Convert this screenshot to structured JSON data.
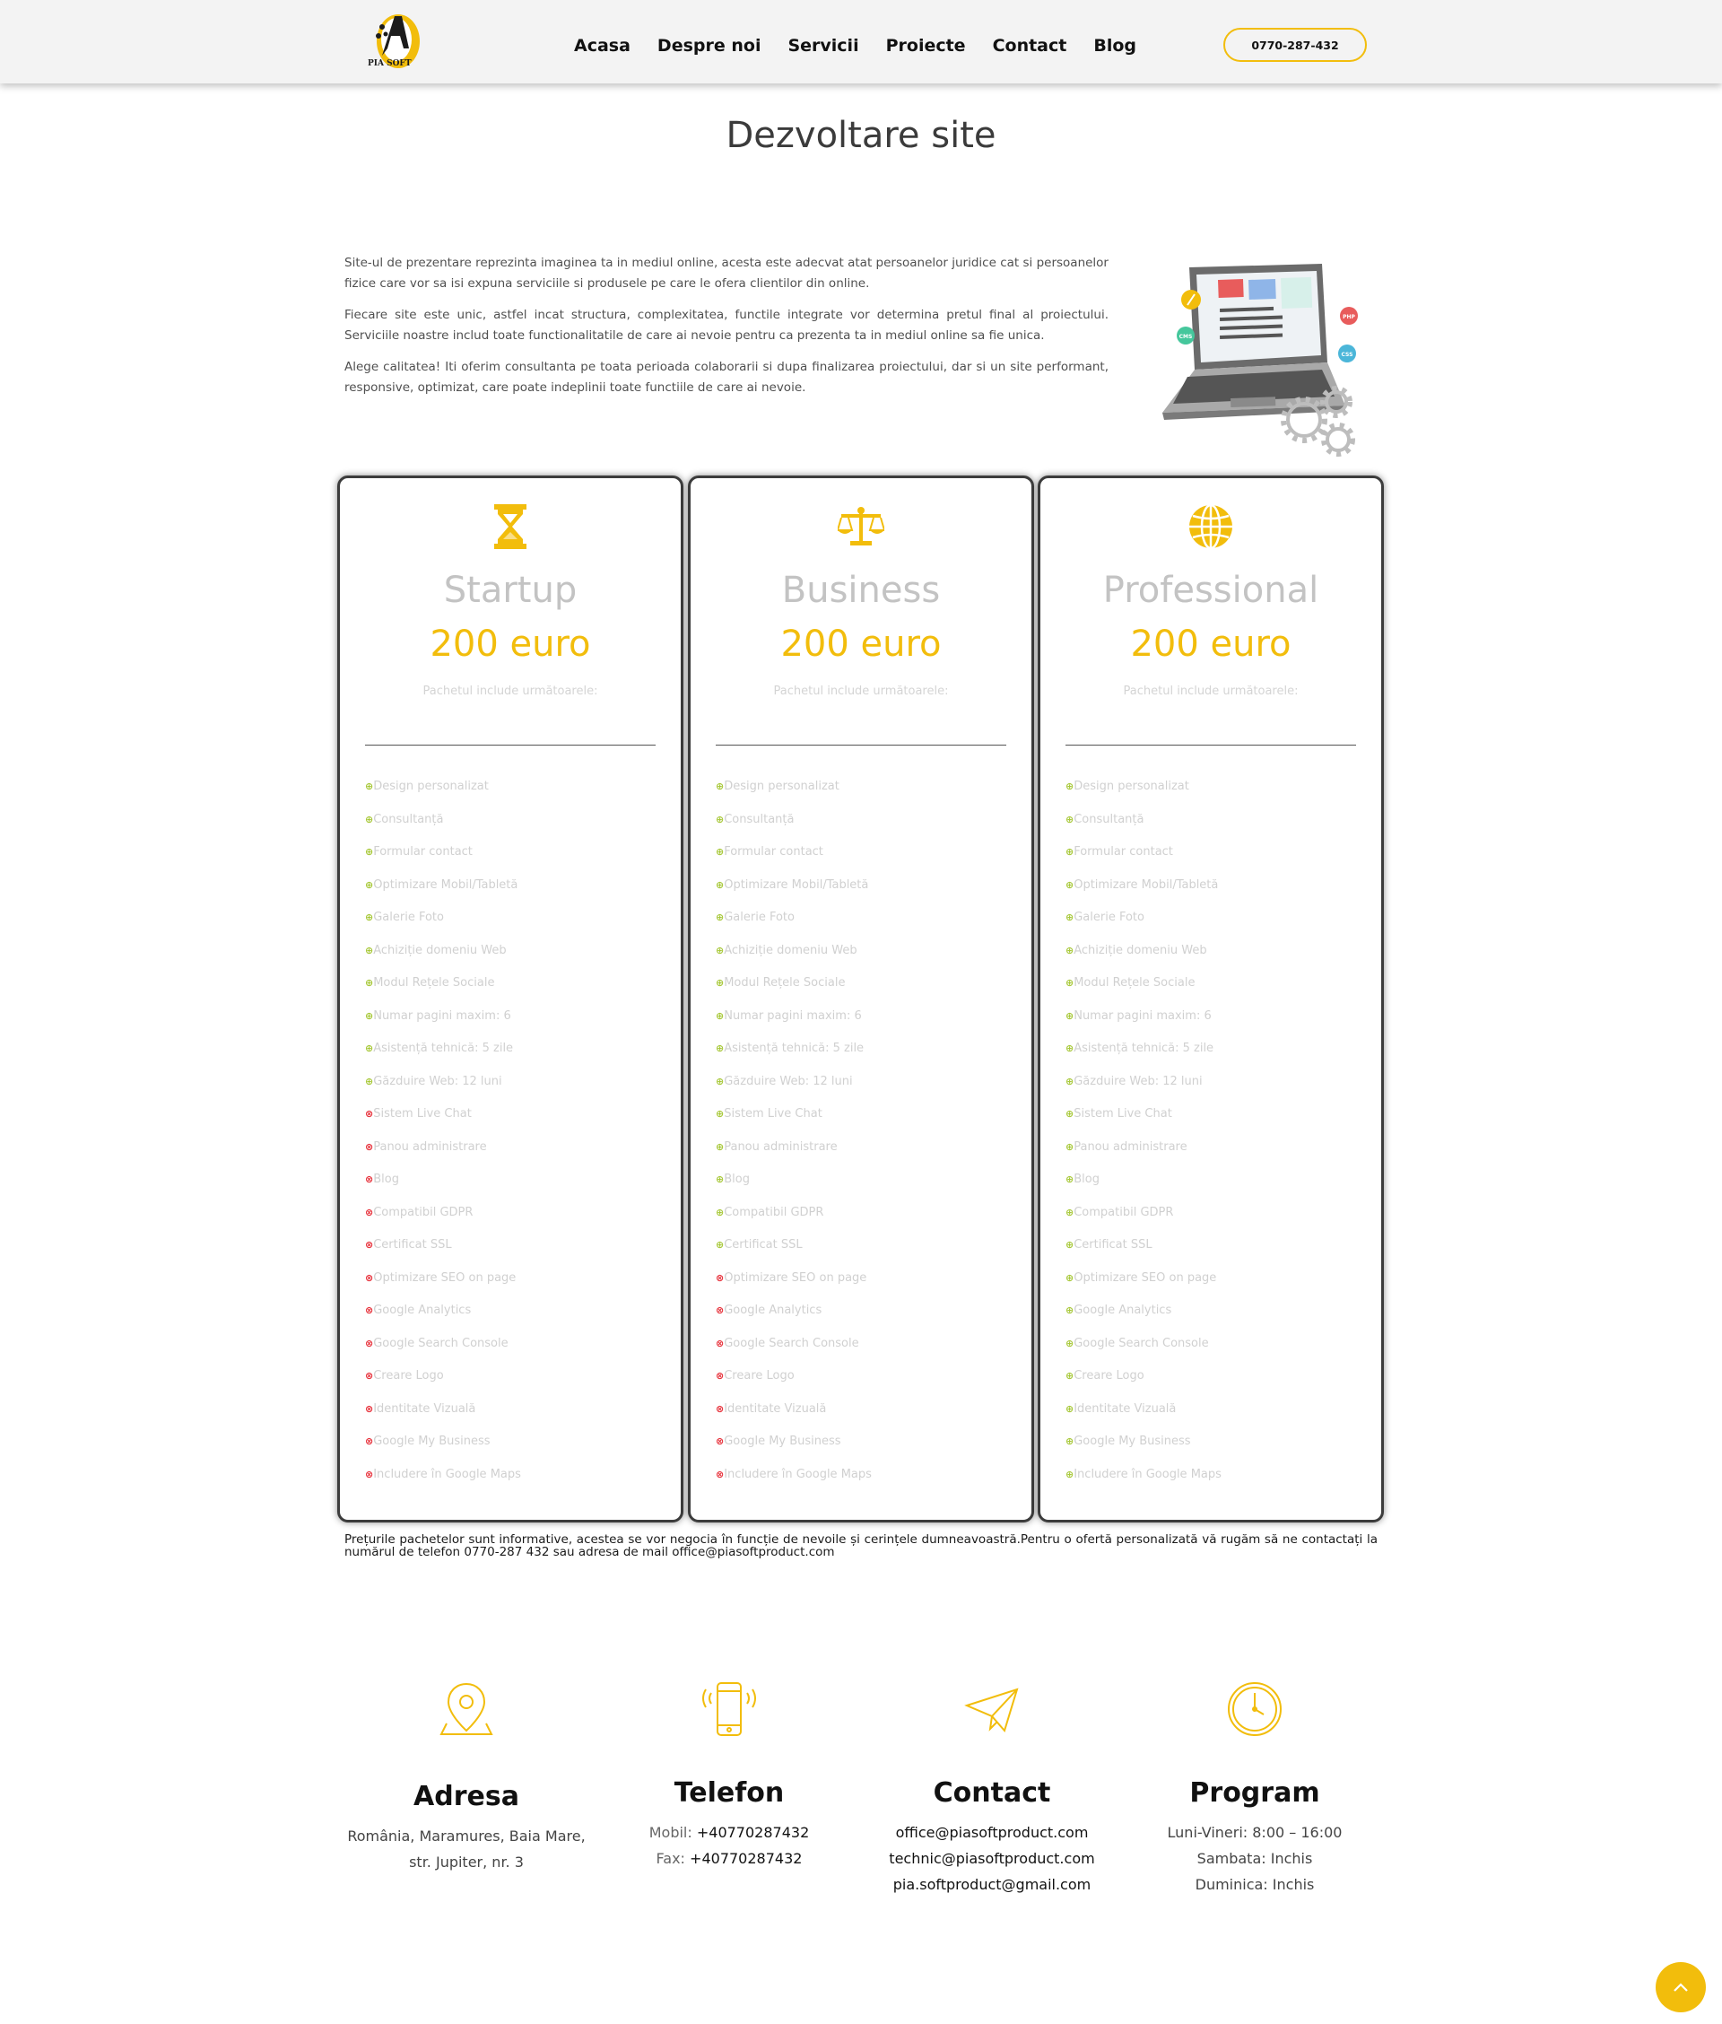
{
  "header": {
    "logo_text": "PIA SOFT",
    "nav": [
      "Acasa",
      "Despre noi",
      "Servicii",
      "Proiecte",
      "Contact",
      "Blog"
    ],
    "phone": "0770-287-432"
  },
  "page_title": "Dezvoltare site",
  "intro": [
    "Site-ul de prezentare reprezinta imaginea ta in mediul online, acesta este adecvat atat persoanelor juridice cat si persoanelor fizice care vor sa isi expuna serviciile si produsele pe care le ofera clientilor din online.",
    "Fiecare site este unic, astfel incat structura, complexitatea, functile integrate vor determina pretul final al proiectului. Serviciile noastre includ toate functionalitatile de care ai nevoie pentru ca prezenta ta in mediul online sa fie unica.",
    "Alege calitatea! Iti oferim consultanta pe toata perioada colaborarii si dupa finalizarea proiectului, dar si un site performant, responsive, optimizat, care poate indeplinii toate functiile de care ai nevoie."
  ],
  "illustration_labels": [
    "PHP",
    "CMS",
    "CSS"
  ],
  "features": [
    "Design personalizat",
    "Consultanță",
    "Formular contact",
    "Optimizare Mobil/Tabletă",
    "Galerie Foto",
    "Achiziție domeniu Web",
    "Modul Rețele Sociale",
    "Numar pagini maxim: 6",
    "Asistență tehnică: 5 zile",
    "Găzduire Web: 12 luni",
    "Sistem Live Chat",
    "Panou administrare",
    "Blog",
    "Compatibil GDPR",
    "Certificat SSL",
    "Optimizare SEO on page",
    "Google Analytics",
    "Google Search Console",
    "Creare Logo",
    "Identitate Vizuală",
    "Google My Business",
    "Includere în Google Maps"
  ],
  "plans": [
    {
      "icon": "hourglass-icon",
      "name": "Startup",
      "price": "200 euro",
      "subtitle": "Pachetul include următoarele:",
      "included_count": 10
    },
    {
      "icon": "scale-icon",
      "name": "Business",
      "price": "200 euro",
      "subtitle": "Pachetul include următoarele:",
      "included_count": 15
    },
    {
      "icon": "globe-icon",
      "name": "Professional",
      "price": "200 euro",
      "subtitle": "Pachetul include următoarele:",
      "included_count": 22
    }
  ],
  "disclaimer": "Prețurile pachetelor sunt informative, acestea se vor negocia în funcție de nevoile și cerințele dumneavoastră.Pentru o ofertă personalizată vă rugăm să ne contactați la numărul de telefon 0770-287 432 sau adresa de mail office@piasoftproduct.com",
  "footer": {
    "address": {
      "title": "Adresa",
      "line1": "România, Maramures, Baia Mare,",
      "line2": "str. Jupiter, nr. 3"
    },
    "phone": {
      "title": "Telefon",
      "mobile_label": "Mobil:",
      "mobile": "+40770287432",
      "fax_label": "Fax:",
      "fax": "+40770287432"
    },
    "contact": {
      "title": "Contact",
      "emails": [
        "office@piasoftproduct.com",
        "technic@piasoftproduct.com",
        "pia.softproduct@gmail.com"
      ]
    },
    "program": {
      "title": "Program",
      "lines": [
        "Luni-Vineri: 8:00 – 16:00",
        "Sambata: Inchis",
        "Duminica: Inchis"
      ]
    }
  },
  "colors": {
    "accent": "#f2bd0c",
    "included": "#a7c838",
    "excluded": "#e7303a"
  }
}
